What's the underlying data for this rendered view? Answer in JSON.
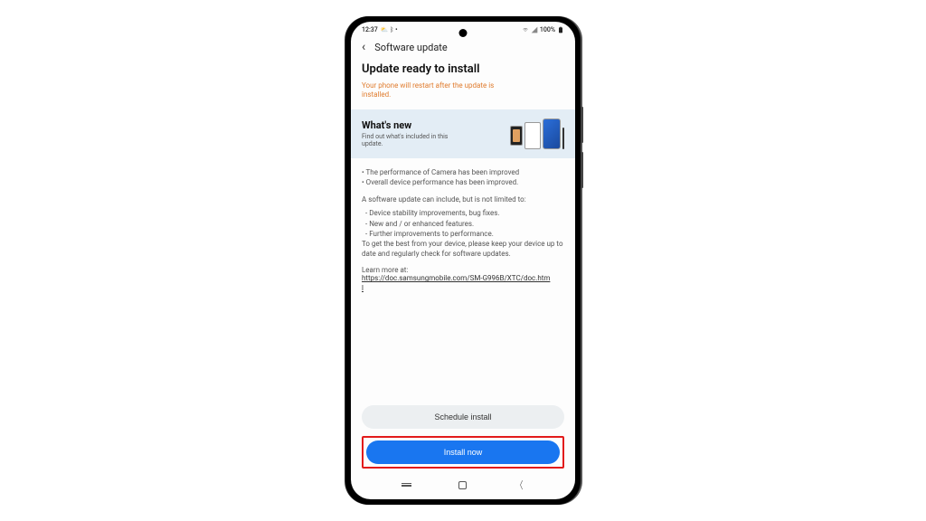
{
  "status_bar": {
    "time": "12:37",
    "icons_left": "⛅ ᛒ •",
    "wifi": true,
    "signal": true,
    "battery_pct": "100%"
  },
  "header": {
    "title": "Software update"
  },
  "main": {
    "title": "Update ready to install",
    "restart_warning": "Your phone will restart after the update is installed.",
    "whats_new": {
      "label": "What's new",
      "subtitle": "Find out what's included in this update."
    },
    "bullets": [
      "• The performance of Camera has been improved",
      "• Overall device performance has been improved."
    ],
    "desc_intro": "A software update can include, but is not limited to:",
    "desc_items": [
      " - Device stability improvements, bug fixes.",
      " - New and / or enhanced features.",
      " - Further improvements to performance."
    ],
    "desc_outro": "To get the best from your device, please keep your device up to date and regularly check for software updates.",
    "learn_more_label": "Learn more at:",
    "learn_more_url": "https://doc.samsungmobile.com/SM-G996B/XTC/doc.html"
  },
  "buttons": {
    "schedule": "Schedule install",
    "install": "Install now"
  }
}
